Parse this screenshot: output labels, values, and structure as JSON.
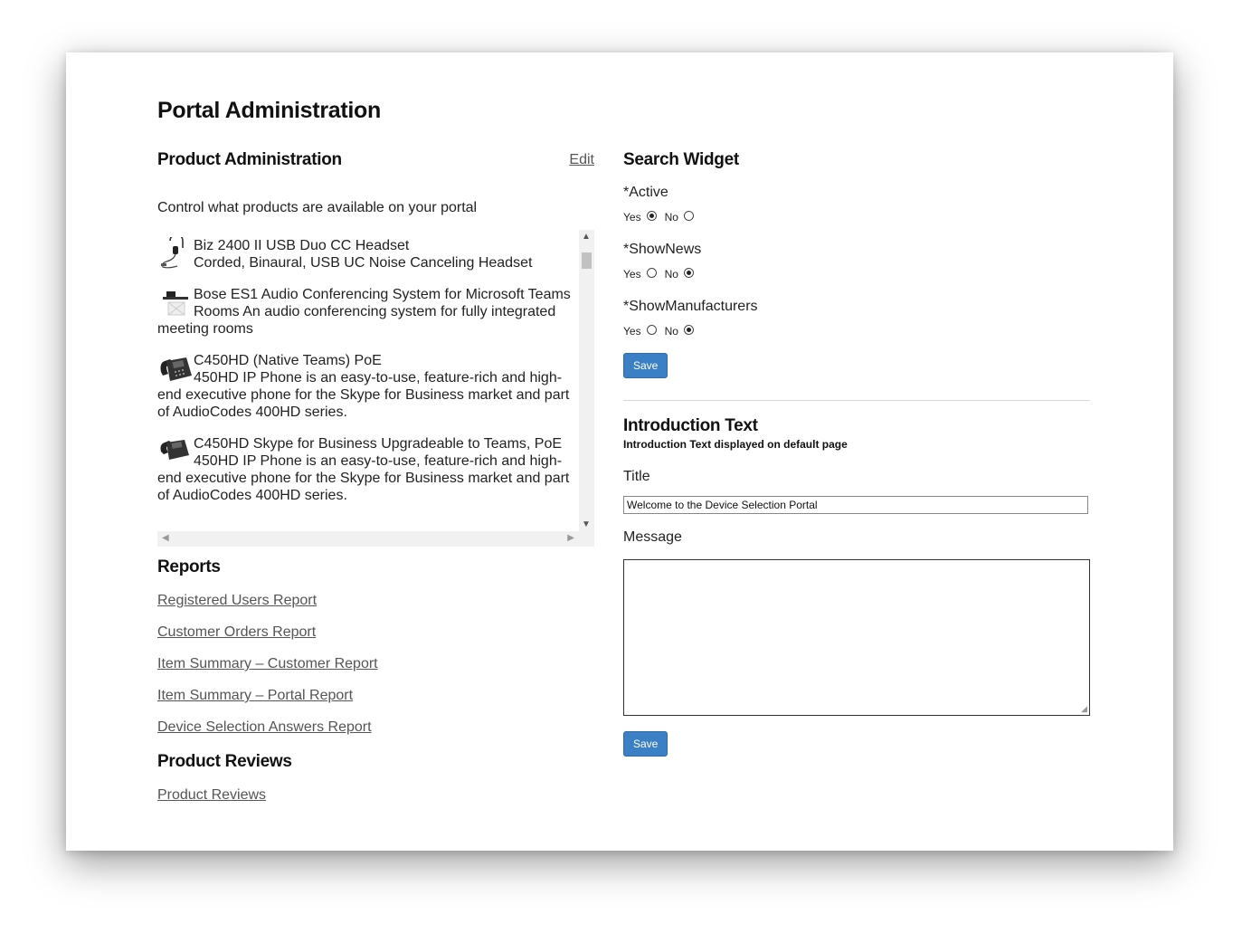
{
  "page": {
    "title": "Portal Administration"
  },
  "product_admin": {
    "heading": "Product Administration",
    "edit_label": "Edit",
    "description": "Control what products are available on your portal",
    "products": [
      {
        "name": "Biz 2400 II USB Duo CC Headset",
        "description": "Corded, Binaural, USB UC Noise Canceling Headset",
        "icon": "headset-icon"
      },
      {
        "name": "Bose ES1 Audio Conferencing System for Microsoft Teams Rooms",
        "description": "An audio conferencing system for fully integrated meeting rooms",
        "icon": "conference-system-icon"
      },
      {
        "name": "C450HD (Native Teams) PoE",
        "description": "450HD IP Phone is an easy-to-use, feature-rich and high-end executive phone for the Skype for Business market and part of AudioCodes 400HD series.",
        "icon": "desk-phone-icon"
      },
      {
        "name": "C450HD Skype for Business Upgradeable to Teams, PoE",
        "description": "450HD IP Phone is an easy-to-use, feature-rich and high-end executive phone for the Skype for Business market and part of AudioCodes 400HD series.",
        "icon": "desk-phone-icon"
      }
    ]
  },
  "reports": {
    "heading": "Reports",
    "links": [
      "Registered Users Report",
      "Customer Orders Report",
      "Item Summary – Customer Report",
      "Item Summary – Portal Report",
      "Device Selection Answers Report"
    ]
  },
  "product_reviews": {
    "heading": "Product Reviews",
    "link": "Product Reviews"
  },
  "search_widget": {
    "heading": "Search Widget",
    "yes_label": "Yes",
    "no_label": "No",
    "fields": [
      {
        "label": "*Active",
        "selected": "Yes"
      },
      {
        "label": "*ShowNews",
        "selected": "No"
      },
      {
        "label": "*ShowManufacturers",
        "selected": "No"
      }
    ],
    "save_label": "Save"
  },
  "introduction": {
    "heading": "Introduction Text",
    "subheading": "Introduction Text displayed on default page",
    "title_label": "Title",
    "title_value": "Welcome to the Device Selection Portal",
    "message_label": "Message",
    "message_value": "",
    "save_label": "Save"
  },
  "colors": {
    "button": "#3b7fc4",
    "link": "#555555"
  }
}
